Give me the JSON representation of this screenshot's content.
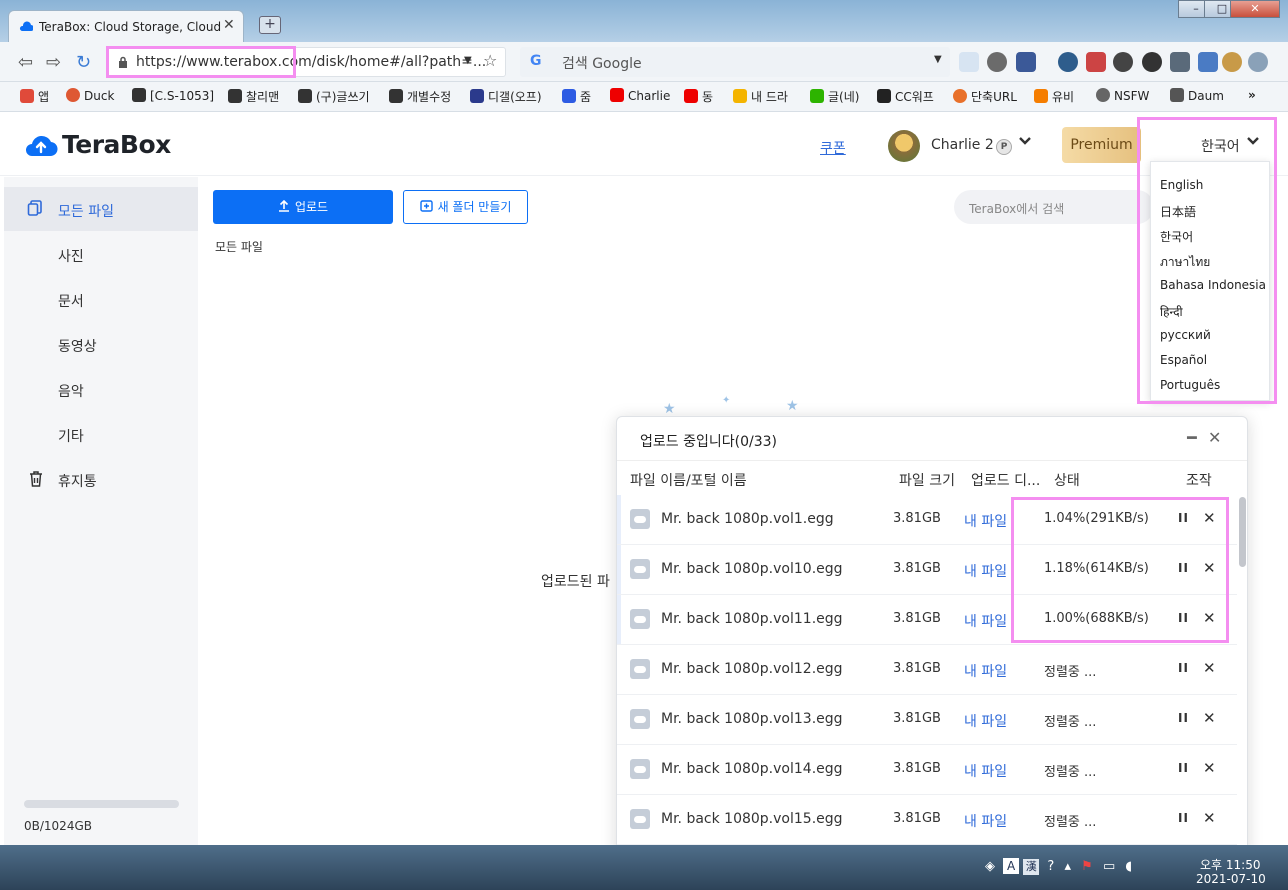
{
  "browser": {
    "tab_title": "TeraBox: Cloud Storage, Cloud Ba",
    "tab_close": "✕",
    "new_tab": "+",
    "url": "https://www.terabox.com/disk/home#/all?path=...",
    "search_engine_label": "G",
    "search_placeholder": "검색 Google",
    "window_controls": [
      "–",
      "□",
      "✕"
    ]
  },
  "bookmarks": [
    "앱",
    "Duck",
    "[C.S-1053]",
    "찰리맨",
    "(구)글쓰기",
    "개별수정",
    "디갤(오프)",
    "줌",
    "Charlie",
    "동",
    "내 드라",
    "글(네)",
    "CC워프",
    "단축URL",
    "유비",
    "NSFW",
    "Daum",
    "»"
  ],
  "header": {
    "logo": "TeraBox",
    "coupon": "쿠폰",
    "username": "Charlie 2",
    "badge": "P",
    "premium": "Premium",
    "language": "한국어"
  },
  "languages": [
    "English",
    "日本語",
    "한국어",
    "ภาษาไทย",
    "Bahasa Indonesia",
    "हिन्दी",
    "русский",
    "Español",
    "Português"
  ],
  "sidebar": {
    "items": [
      {
        "label": "모든 파일"
      },
      {
        "label": "사진"
      },
      {
        "label": "문서"
      },
      {
        "label": "동영상"
      },
      {
        "label": "음악"
      },
      {
        "label": "기타"
      },
      {
        "label": "휴지통"
      }
    ],
    "quota": "0B/1024GB",
    "quota_used_fraction": 0
  },
  "main": {
    "upload_button": "업로드",
    "new_folder_button": "새 폴더 만들기",
    "search_placeholder": "TeraBox에서 검색",
    "breadcrumb": "모든 파일",
    "empty_text": "업로드된 파"
  },
  "upload_panel": {
    "title": "업로드 중입니다(0/33)",
    "columns": [
      "파일 이름/포털 이름",
      "파일 크기",
      "업로드 디...",
      "상태",
      "조작"
    ],
    "rows": [
      {
        "name": "Mr. back 1080p.vol1.egg",
        "size": "3.81GB",
        "dest": "내 파일",
        "status": "1.04%(291KB/s)"
      },
      {
        "name": "Mr. back 1080p.vol10.egg",
        "size": "3.81GB",
        "dest": "내 파일",
        "status": "1.18%(614KB/s)"
      },
      {
        "name": "Mr. back 1080p.vol11.egg",
        "size": "3.81GB",
        "dest": "내 파일",
        "status": "1.00%(688KB/s)"
      },
      {
        "name": "Mr. back 1080p.vol12.egg",
        "size": "3.81GB",
        "dest": "내 파일",
        "status": "정렬중 ..."
      },
      {
        "name": "Mr. back 1080p.vol13.egg",
        "size": "3.81GB",
        "dest": "내 파일",
        "status": "정렬중 ..."
      },
      {
        "name": "Mr. back 1080p.vol14.egg",
        "size": "3.81GB",
        "dest": "내 파일",
        "status": "정렬중 ..."
      },
      {
        "name": "Mr. back 1080p.vol15.egg",
        "size": "3.81GB",
        "dest": "내 파일",
        "status": "정렬중 ..."
      }
    ],
    "pause_glyph": "II",
    "cancel_glyph": "✕"
  },
  "taskbar": {
    "time": "오후 11:50",
    "date": "2021-07-10"
  }
}
